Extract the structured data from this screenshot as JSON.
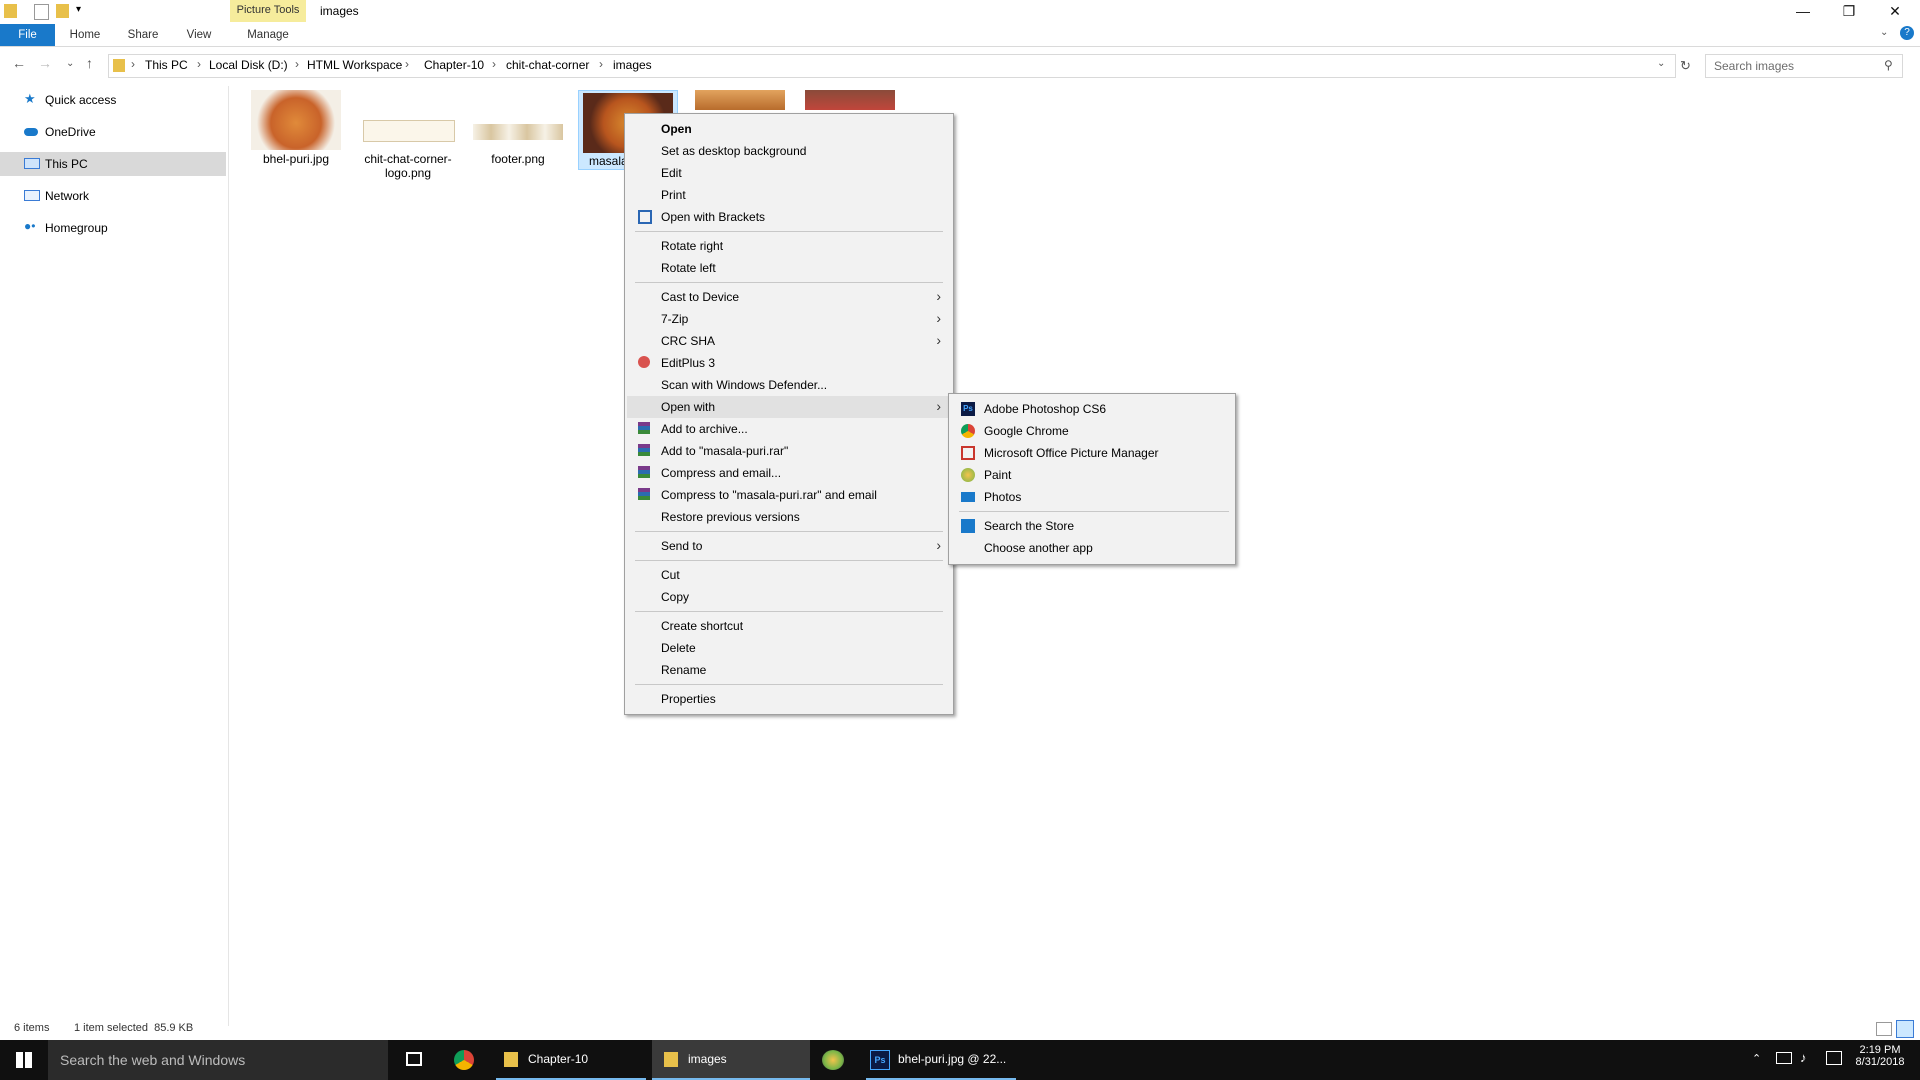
{
  "window": {
    "title": "images",
    "context_tab": "Picture Tools",
    "min": "—",
    "max": "❐",
    "close": "✕"
  },
  "ribbon": {
    "tabs": [
      "File",
      "Home",
      "Share",
      "View",
      "Manage"
    ]
  },
  "address": {
    "crumbs": [
      "This PC",
      "Local Disk (D:)",
      "HTML Workspace",
      "Chapter-10",
      "chit-chat-corner",
      "images"
    ]
  },
  "search": {
    "placeholder": "Search images"
  },
  "nav": {
    "items": [
      "Quick access",
      "OneDrive",
      "This PC",
      "Network",
      "Homegroup"
    ]
  },
  "files": [
    {
      "name": "bhel-puri.jpg"
    },
    {
      "name": "chit-chat-corner-logo.png"
    },
    {
      "name": "footer.png"
    },
    {
      "name": "masala"
    }
  ],
  "context_menu": {
    "items": [
      "Open",
      "Set as desktop background",
      "Edit",
      "Print",
      "Open with Brackets",
      "Rotate right",
      "Rotate left",
      "Cast to Device",
      "7-Zip",
      "CRC SHA",
      "EditPlus 3",
      "Scan with Windows Defender...",
      "Open with",
      "Add to archive...",
      "Add to \"masala-puri.rar\"",
      "Compress and email...",
      "Compress to \"masala-puri.rar\" and email",
      "Restore previous versions",
      "Send to",
      "Cut",
      "Copy",
      "Create shortcut",
      "Delete",
      "Rename",
      "Properties"
    ]
  },
  "open_with_submenu": {
    "items": [
      "Adobe Photoshop CS6",
      "Google Chrome",
      "Microsoft Office Picture Manager",
      "Paint",
      "Photos",
      "Search the Store",
      "Choose another app"
    ]
  },
  "status": {
    "count": "6 items",
    "selection": "1 item selected  85.9 KB"
  },
  "taskbar": {
    "search": "Search the web and Windows",
    "apps": [
      "Chapter-10",
      "images",
      "bhel-puri.jpg @ 22..."
    ],
    "time": "2:19 PM",
    "date": "8/31/2018"
  },
  "colors": {
    "accent": "#1979ca",
    "picture_tools": "#f6ec9c",
    "selection": "#cce8ff",
    "taskbar": "#101010"
  }
}
